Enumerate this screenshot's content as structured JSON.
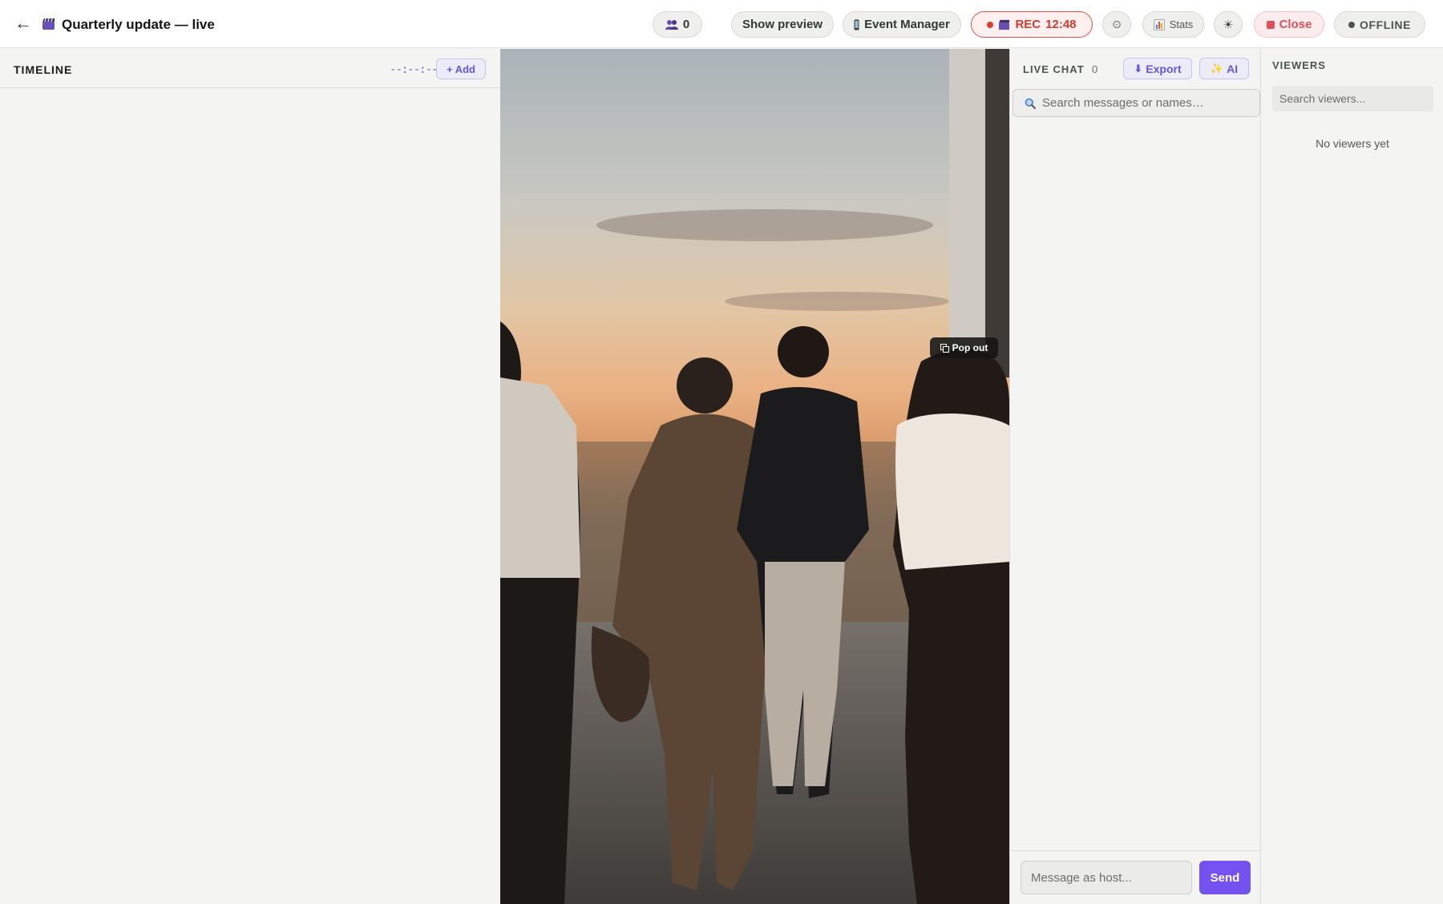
{
  "header": {
    "title": "Quarterly update — live",
    "viewer_count": "0",
    "show_preview": "Show preview",
    "event_manager": "Event Manager",
    "rec_label": "REC",
    "rec_time": "12:48",
    "stats": "Stats",
    "close": "Close",
    "status": "OFFLINE"
  },
  "timeline": {
    "title": "TIMELINE",
    "time": "--:--:--",
    "add_label": "+ Add"
  },
  "video": {
    "popout_label": "Pop out"
  },
  "chat": {
    "title": "LIVE CHAT",
    "count": "0",
    "export_label": "Export",
    "ai_label": "AI",
    "search_placeholder": "Search messages or names…",
    "message_placeholder": "Message as host...",
    "send_label": "Send"
  },
  "viewers": {
    "title": "VIEWERS",
    "search_placeholder": "Search viewers...",
    "empty_text": "No viewers yet"
  },
  "colors": {
    "accent": "#7352f0",
    "rec": "#d8392d",
    "close": "#e0505a"
  }
}
